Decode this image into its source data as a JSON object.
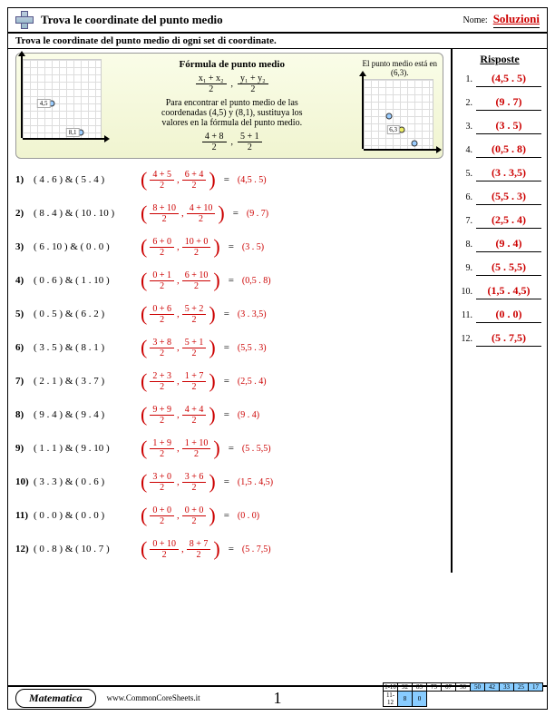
{
  "header": {
    "title": "Trova le coordinate del punto medio",
    "nome_label": "Nome:",
    "solutions": "Soluzioni"
  },
  "instruction": "Trova le coordinate del punto medio di ogni set di coordinate.",
  "example": {
    "formula_title": "Fórmula de punto medio",
    "f1t": "x₁ + x₂",
    "f1b": "2",
    "f2t": "y₁ + y₂",
    "f2b": "2",
    "desc1": "Para encontrar el punto medio de las",
    "desc2": "coordenadas (4,5) y (8,1), sustituya los",
    "desc3": "valores en la fórmula del punto medio.",
    "f3t": "4 + 8",
    "f3b": "2",
    "f4t": "5 + 1",
    "f4b": "2",
    "right1": "El punto medio está en",
    "right2": "(6,3).",
    "p1": "4,5",
    "p2": "8,1",
    "pm": "6,3"
  },
  "answers_title": "Risposte",
  "answers": [
    "(4,5 . 5)",
    "(9 . 7)",
    "(3 . 5)",
    "(0,5 . 8)",
    "(3 . 3,5)",
    "(5,5 . 3)",
    "(2,5 . 4)",
    "(9 . 4)",
    "(5 . 5,5)",
    "(1,5 . 4,5)",
    "(0 . 0)",
    "(5 . 7,5)"
  ],
  "problems": [
    {
      "n": "1)",
      "c": "( 4 . 6 ) & ( 5 . 4 )",
      "t1": "4 + 5",
      "t2": "6 + 4",
      "r": "(4,5 . 5)"
    },
    {
      "n": "2)",
      "c": "( 8 . 4 ) & ( 10 . 10 )",
      "t1": "8 + 10",
      "t2": "4 + 10",
      "r": "(9 . 7)"
    },
    {
      "n": "3)",
      "c": "( 6 . 10 ) & ( 0 . 0 )",
      "t1": "6 + 0",
      "t2": "10 + 0",
      "r": "(3 . 5)"
    },
    {
      "n": "4)",
      "c": "( 0 . 6 ) & ( 1 . 10 )",
      "t1": "0 + 1",
      "t2": "6 + 10",
      "r": "(0,5 . 8)"
    },
    {
      "n": "5)",
      "c": "( 0 . 5 ) & ( 6 . 2 )",
      "t1": "0 + 6",
      "t2": "5 + 2",
      "r": "(3 . 3,5)"
    },
    {
      "n": "6)",
      "c": "( 3 . 5 ) & ( 8 . 1 )",
      "t1": "3 + 8",
      "t2": "5 + 1",
      "r": "(5,5 . 3)"
    },
    {
      "n": "7)",
      "c": "( 2 . 1 ) & ( 3 . 7 )",
      "t1": "2 + 3",
      "t2": "1 + 7",
      "r": "(2,5 . 4)"
    },
    {
      "n": "8)",
      "c": "( 9 . 4 ) & ( 9 . 4 )",
      "t1": "9 + 9",
      "t2": "4 + 4",
      "r": "(9 . 4)"
    },
    {
      "n": "9)",
      "c": "( 1 . 1 ) & ( 9 . 10 )",
      "t1": "1 + 9",
      "t2": "1 + 10",
      "r": "(5 . 5,5)"
    },
    {
      "n": "10)",
      "c": "( 3 . 3 ) & ( 0 . 6 )",
      "t1": "3 + 0",
      "t2": "3 + 6",
      "r": "(1,5 . 4,5)"
    },
    {
      "n": "11)",
      "c": "( 0 . 0 ) & ( 0 . 0 )",
      "t1": "0 + 0",
      "t2": "0 + 0",
      "r": "(0 . 0)"
    },
    {
      "n": "12)",
      "c": "( 0 . 8 ) & ( 10 . 7 )",
      "t1": "0 + 10",
      "t2": "8 + 7",
      "r": "(5 . 7,5)"
    }
  ],
  "footer": {
    "subject": "Matematica",
    "url": "www.CommonCoreSheets.it",
    "page": "1"
  },
  "score": {
    "r1l": "1-10",
    "r1": [
      "92",
      "83",
      "75",
      "67",
      "58",
      "50",
      "42",
      "33",
      "25",
      "17"
    ],
    "r2l": "11-12",
    "r2": [
      "8",
      "0"
    ]
  }
}
